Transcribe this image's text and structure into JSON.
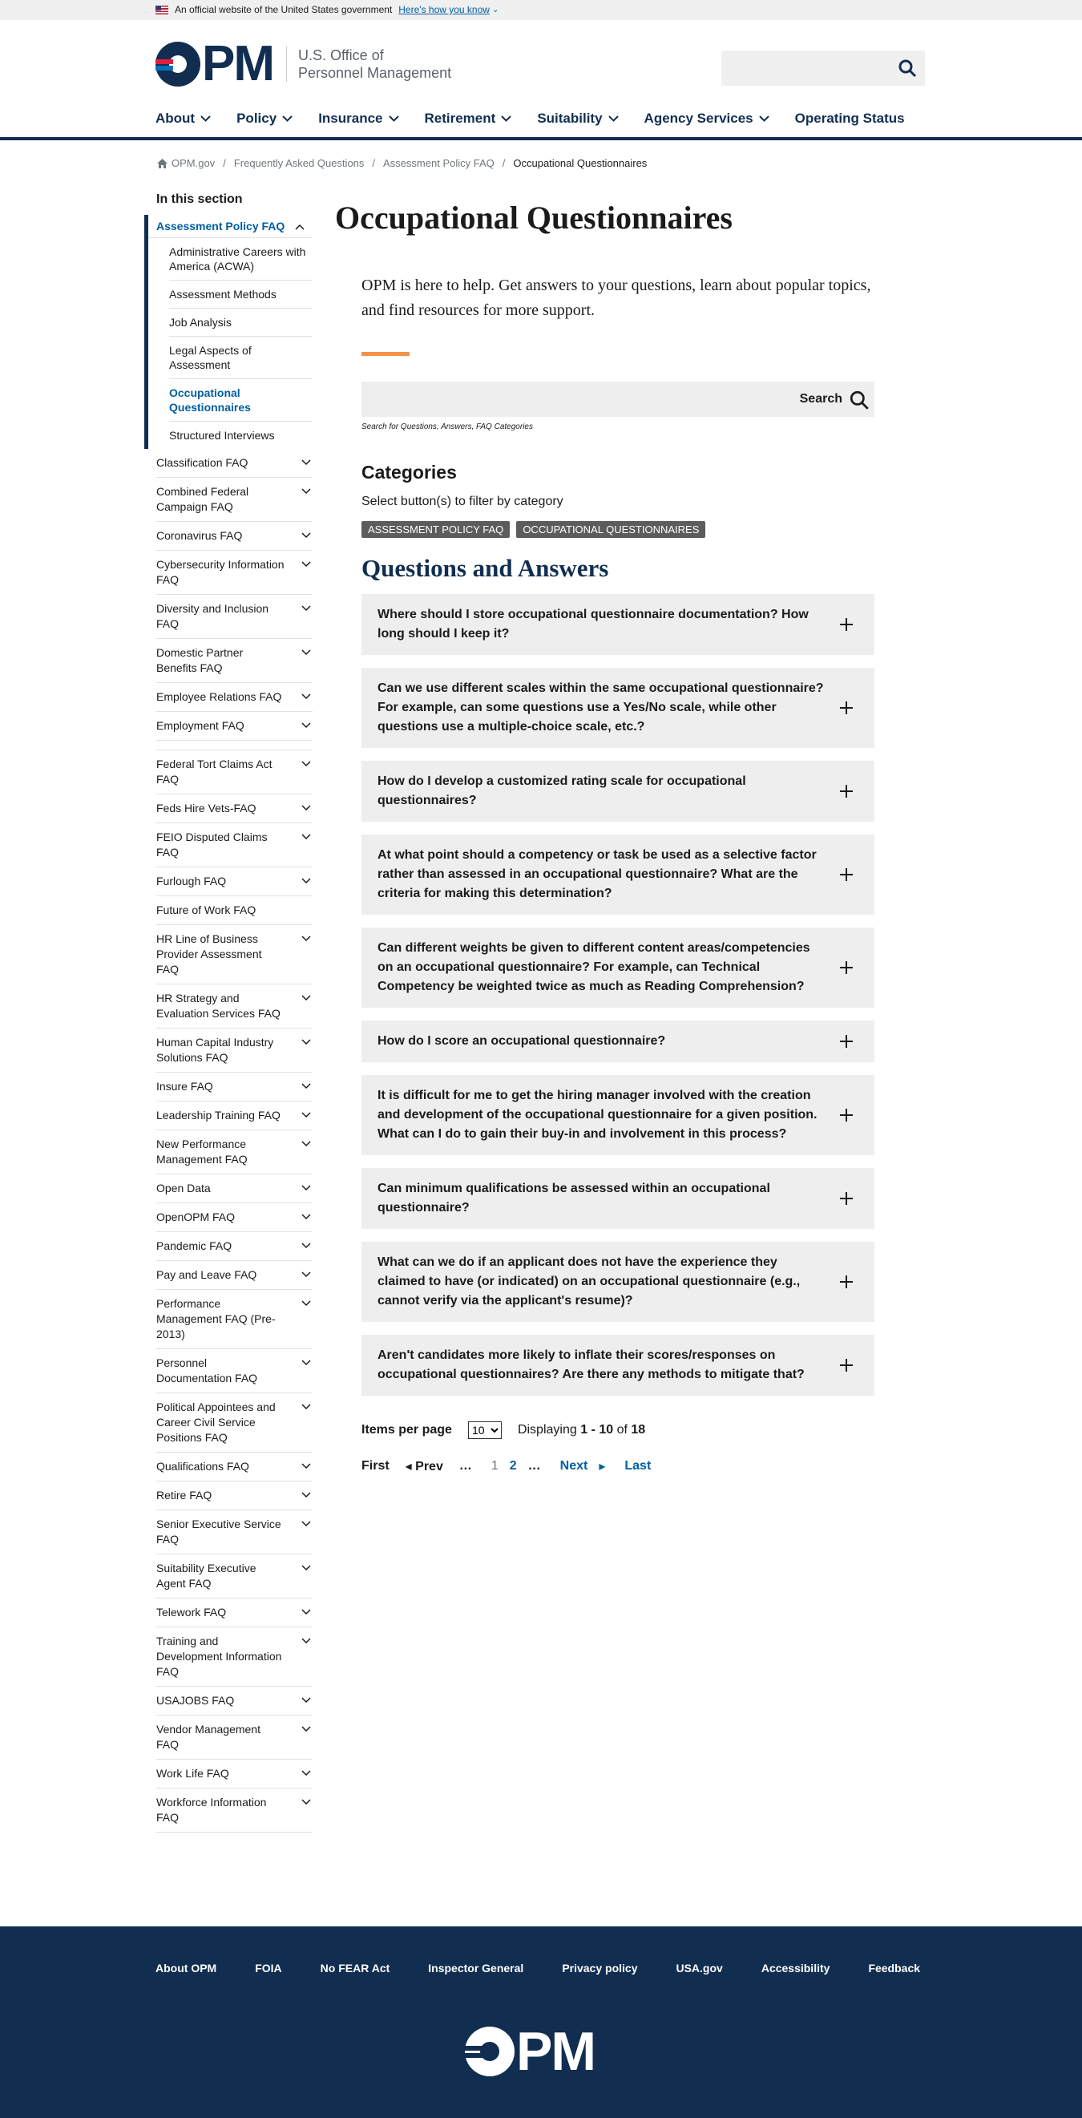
{
  "gov_banner": {
    "text": "An official website of the United States government",
    "link": "Here's how you know"
  },
  "header": {
    "logo_letters": "PM",
    "agency_line1": "U.S. Office of",
    "agency_line2": "Personnel Management",
    "search_placeholder": ""
  },
  "nav": {
    "items": [
      "About",
      "Policy",
      "Insurance",
      "Retirement",
      "Suitability",
      "Agency Services",
      "Operating Status"
    ]
  },
  "breadcrumb": [
    "OPM.gov",
    "Frequently Asked Questions",
    "Assessment Policy FAQ",
    "Occupational Questionnaires"
  ],
  "sidebar": {
    "heading": "In this section",
    "current": "Assessment Policy FAQ",
    "sub_items": [
      "Administrative Careers with America (ACWA)",
      "Assessment Methods",
      "Job Analysis",
      "Legal Aspects of Assessment",
      "Occupational Questionnaires",
      "Structured Interviews"
    ],
    "items_a": [
      "Classification FAQ",
      "Combined Federal Campaign FAQ",
      "Coronavirus FAQ",
      "Cybersecurity Information FAQ",
      "Diversity and Inclusion FAQ",
      "Domestic Partner Benefits FAQ",
      "Employee Relations FAQ",
      "Employment FAQ"
    ],
    "items_b": [
      "Federal Tort Claims Act FAQ",
      "Feds Hire Vets-FAQ",
      "FEIO Disputed Claims FAQ",
      "Furlough FAQ",
      "Future of Work FAQ",
      "HR Line of Business Provider Assessment FAQ",
      "HR Strategy and Evaluation Services FAQ",
      "Human Capital Industry Solutions FAQ",
      "Insure FAQ",
      "Leadership Training FAQ",
      "New Performance Management FAQ",
      "Open Data",
      "OpenOPM FAQ",
      "Pandemic FAQ",
      "Pay and Leave FAQ",
      "Performance Management FAQ (Pre-2013)",
      "Personnel Documentation FAQ",
      "Political Appointees and Career Civil Service Positions FAQ",
      "Qualifications FAQ",
      "Retire FAQ",
      "Senior Executive Service FAQ",
      "Suitability Executive Agent FAQ",
      "Telework FAQ",
      "Training and Development Information FAQ",
      "USAJOBS FAQ",
      "Vendor Management FAQ",
      "Work Life FAQ",
      "Workforce Information FAQ"
    ]
  },
  "main": {
    "title": "Occupational Questionnaires",
    "intro": "OPM is here to help. Get answers to your questions, learn about popular topics, and find resources for more support.",
    "search_label": "Search",
    "search_hint": "Search for Questions, Answers, FAQ Categories",
    "categories_heading": "Categories",
    "categories_text": "Select button(s) to filter by category",
    "tags": [
      "ASSESSMENT POLICY FAQ",
      "OCCUPATIONAL QUESTIONNAIRES"
    ],
    "qa_heading": "Questions and Answers",
    "questions": [
      "Where should I store occupational questionnaire documentation? How long should I keep it?",
      "Can we use different scales within the same occupational questionnaire? For example, can some questions use a Yes/No scale, while other questions use a multiple-choice scale, etc.?",
      "How do I develop a customized rating scale for occupational questionnaires?",
      "At what point should a competency or task be used as a selective factor rather than assessed in an occupational questionnaire? What are the criteria for making this determination?",
      "Can different weights be given to different content areas/competencies on an occupational questionnaire? For example, can Technical Competency be weighted twice as much as Reading Comprehension?",
      "How do I score an occupational questionnaire?",
      "It is difficult for me to get the hiring manager involved with the creation and development of the occupational questionnaire for a given position. What can I do to gain their buy-in and involvement in this process?",
      "Can minimum qualifications be assessed within an occupational questionnaire?",
      "What can we do if an applicant does not have the experience they claimed to have (or indicated) on an occupational questionnaire (e.g., cannot verify via the applicant's resume)?",
      "Aren't candidates more likely to inflate their scores/responses on occupational questionnaires? Are there any methods to mitigate that?"
    ],
    "items_per_page_label": "Items per page",
    "items_per_page_value": "10",
    "displaying_prefix": "Displaying",
    "displaying_range": "1 - 10",
    "displaying_of": "of",
    "displaying_total": "18",
    "pager": {
      "first": "First",
      "prev": "◂ Prev",
      "dots": "…",
      "page1": "1",
      "page2": "2",
      "next": "Next",
      "next_arrow": "▸",
      "last": "Last"
    }
  },
  "footer": {
    "links": [
      "About OPM",
      "FOIA",
      "No FEAR Act",
      "Inspector General",
      "Privacy policy",
      "USA.gov",
      "Accessibility",
      "Feedback"
    ],
    "logo_letters": "PM"
  },
  "colors": {
    "navy": "#112e51",
    "link_blue": "#005ea2",
    "accent_orange": "#f2934a",
    "tag_gray": "#5c5c5c",
    "panel_gray": "#eeeeee"
  }
}
